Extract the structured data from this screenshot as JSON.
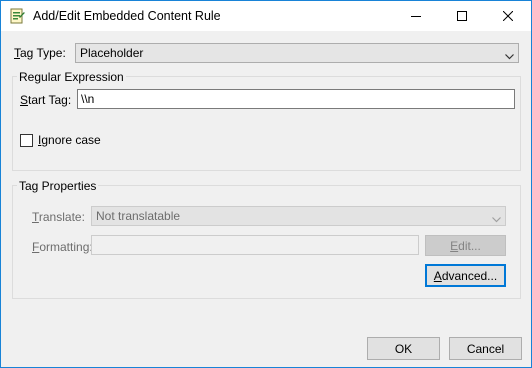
{
  "window": {
    "title": "Add/Edit Embedded Content Rule",
    "icon": "rule-editor-icon",
    "controls": [
      "minimize-icon",
      "maximize-icon",
      "close-icon"
    ]
  },
  "tag_type": {
    "label_mnemonic": "T",
    "label_rest": "ag Type:",
    "value": "Placeholder"
  },
  "regex_group": {
    "title": "Regular Expression",
    "start_tag_label_mnemonic": "S",
    "start_tag_label_rest": "tart Tag:",
    "start_tag_value": "\\\\n",
    "ignore_case_mnemonic": "I",
    "ignore_case_rest": "gnore case",
    "ignore_case_checked": false
  },
  "tag_props_group": {
    "title": "Tag Properties",
    "translate_label_mnemonic": "T",
    "translate_label_rest": "ranslate:",
    "translate_value": "Not translatable",
    "formatting_label_mnemonic": "F",
    "formatting_label_rest": "ormatting:",
    "formatting_value": "",
    "edit_button_mnemonic": "E",
    "edit_button_rest": "dit...",
    "advanced_button_mnemonic": "A",
    "advanced_button_rest": "dvanced..."
  },
  "footer": {
    "ok_label": "OK",
    "cancel_label": "Cancel"
  },
  "colors": {
    "window_border": "#1883d7",
    "dialog_background": "#f0f0f0",
    "default_button_accent": "#0078d7",
    "disabled_text": "#6d6d6d"
  }
}
